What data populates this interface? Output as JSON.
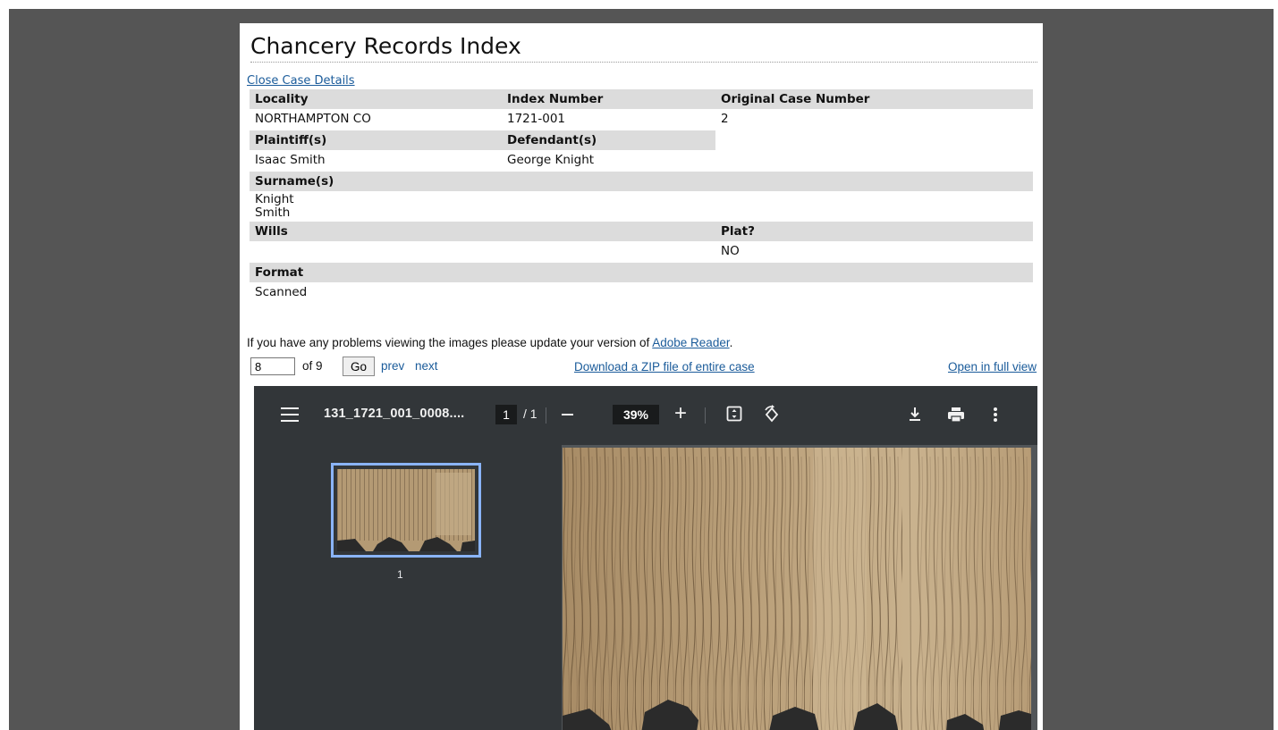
{
  "title": "Chancery Records Index",
  "close_link": "Close Case Details",
  "details": {
    "locality_label": "Locality",
    "locality": "NORTHAMPTON CO",
    "index_number_label": "Index Number",
    "index_number": "1721-001",
    "original_case_label": "Original Case Number",
    "original_case": "2",
    "plaintiffs_label": "Plaintiff(s)",
    "plaintiffs": "Isaac Smith",
    "defendants_label": "Defendant(s)",
    "defendants": "George Knight",
    "surnames_label": "Surname(s)",
    "surnames": [
      "Knight",
      "Smith"
    ],
    "wills_label": "Wills",
    "wills": "",
    "plat_label": "Plat?",
    "plat": "NO",
    "format_label": "Format",
    "format": "Scanned"
  },
  "notice": {
    "text_before": "If you have any problems viewing the images please update your version of ",
    "link": "Adobe Reader",
    "text_after": "."
  },
  "navigation": {
    "page_value": "8",
    "of_label": "of 9",
    "go_label": "Go",
    "prev_label": "prev",
    "next_label": "next",
    "zip_link": "Download a ZIP file of entire case",
    "full_view_link": "Open in full view"
  },
  "viewer": {
    "file_name": "131_1721_001_0008....",
    "current_page": "1",
    "total_pages": "/ 1",
    "zoom": "39%",
    "thumbnail_label": "1",
    "icons": [
      "menu-icon",
      "minus-icon",
      "plus-icon",
      "fit-page-icon",
      "rotate-icon",
      "download-icon",
      "print-icon",
      "more-icon"
    ]
  },
  "colors": {
    "background": "#555555",
    "link": "#1a5b9a",
    "header_row": "#dcdcdc",
    "viewer_toolbar": "#323639",
    "viewer_bg": "#525659",
    "thumb_highlight": "#8ab4f8",
    "parchment": "#b49a74"
  }
}
